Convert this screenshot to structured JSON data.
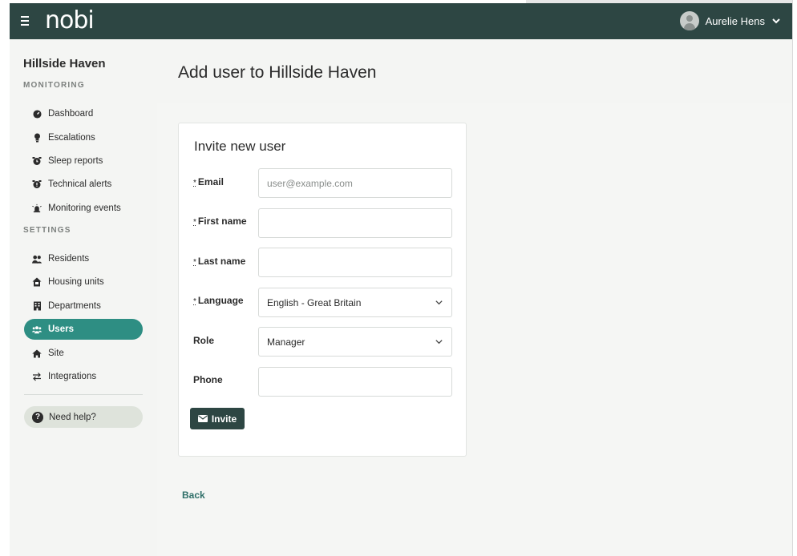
{
  "app": {
    "brand": "nobi",
    "user_name": "Aurelie Hens"
  },
  "sidebar": {
    "site_name": "Hillside Haven",
    "monitoring_label": "MONITORING",
    "settings_label": "SETTINGS",
    "monitoring_items": [
      {
        "label": "Dashboard",
        "icon": "gauge-icon"
      },
      {
        "label": "Escalations",
        "icon": "lightbulb-icon"
      },
      {
        "label": "Sleep reports",
        "icon": "alarm-clock-icon"
      },
      {
        "label": "Technical alerts",
        "icon": "alarm-clock-alert-icon"
      },
      {
        "label": "Monitoring events",
        "icon": "siren-icon"
      }
    ],
    "settings_items": [
      {
        "label": "Residents",
        "icon": "users-icon"
      },
      {
        "label": "Housing units",
        "icon": "house-icon"
      },
      {
        "label": "Departments",
        "icon": "building-icon"
      },
      {
        "label": "Users",
        "icon": "user-group-icon",
        "active": true
      },
      {
        "label": "Site",
        "icon": "home-icon"
      },
      {
        "label": "Integrations",
        "icon": "arrows-exchange-icon"
      }
    ],
    "help_label": "Need help?"
  },
  "main": {
    "title": "Add user to Hillside Haven",
    "form": {
      "title": "Invite new user",
      "required_marker": "*",
      "fields": {
        "email": {
          "label": "Email",
          "value": "",
          "placeholder": "user@example.com"
        },
        "first_name": {
          "label": "First name",
          "value": ""
        },
        "last_name": {
          "label": "Last name",
          "value": ""
        },
        "language": {
          "label": "Language",
          "value": "English - Great Britain"
        },
        "role": {
          "label": "Role",
          "value": "Manager"
        },
        "phone": {
          "label": "Phone",
          "value": ""
        }
      },
      "invite_label": "Invite"
    },
    "back_label": "Back"
  },
  "colors": {
    "topbar": "#2d4643",
    "accent": "#2e8e83",
    "background": "#f4f5f3"
  }
}
